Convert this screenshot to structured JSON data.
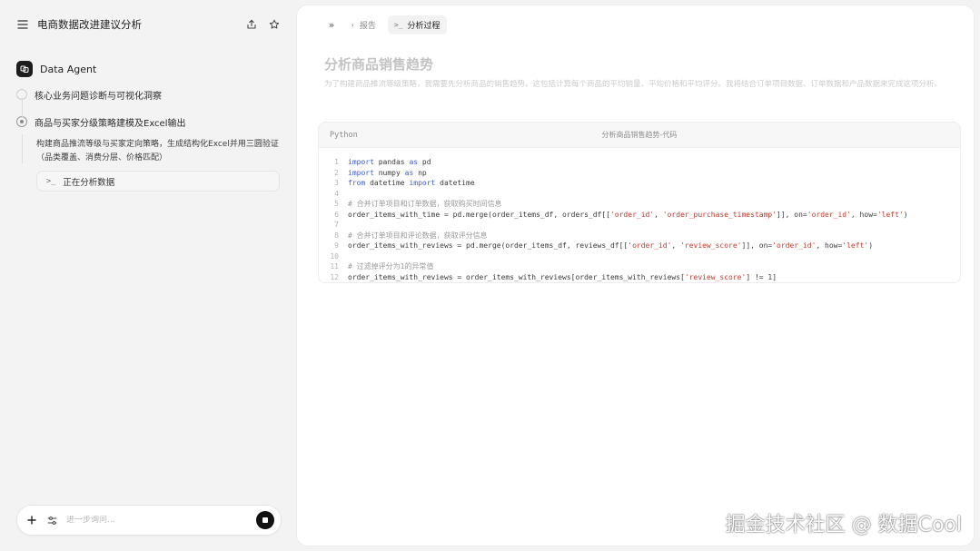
{
  "sidebar": {
    "title": "电商数据改进建议分析",
    "agent_name": "Data Agent",
    "steps": [
      {
        "label": "核心业务问题诊断与可视化洞察"
      },
      {
        "label": "商品与买家分级策略建模及Excel输出"
      }
    ],
    "step_description": "构建商品推流等级与买家定向策略，生成结构化Excel并用三圆验证（品类覆盖、消费分层、价格匹配）",
    "status": {
      "icon_text": ">_",
      "label": "正在分析数据"
    },
    "input": {
      "placeholder": "进一步询问..."
    }
  },
  "main": {
    "tabs": [
      {
        "label": "报告",
        "icon_text": "‹"
      },
      {
        "label": "分析过程",
        "icon_text": ">_",
        "active": true
      }
    ],
    "report_title": "分析商品销售趋势",
    "report_description": "为了构建商品推流等级策略，我需要先分析商品的销售趋势。这包括计算每个商品的平均销量、平均价格和平均评分。我将结合订单项目数据、订单数据和产品数据来完成这项分析。",
    "code_block": {
      "language": "Python",
      "title": "分析商品销售趋势-代码",
      "lines": [
        {
          "n": "1",
          "parts": [
            [
              "kw",
              "import"
            ],
            [
              "p",
              " pandas "
            ],
            [
              "kw",
              "as"
            ],
            [
              "p",
              " pd"
            ]
          ]
        },
        {
          "n": "2",
          "parts": [
            [
              "kw",
              "import"
            ],
            [
              "p",
              " numpy "
            ],
            [
              "kw",
              "as"
            ],
            [
              "p",
              " np"
            ]
          ]
        },
        {
          "n": "3",
          "parts": [
            [
              "kw",
              "from"
            ],
            [
              "p",
              " datetime "
            ],
            [
              "kw",
              "import"
            ],
            [
              "p",
              " datetime"
            ]
          ]
        },
        {
          "n": "4",
          "parts": []
        },
        {
          "n": "5",
          "parts": [
            [
              "cm",
              "# 合并订单项目和订单数据，获取购买时间信息"
            ]
          ]
        },
        {
          "n": "6",
          "parts": [
            [
              "p",
              "order_items_with_time = pd.merge(order_items_df, orders_df[["
            ],
            [
              "str",
              "'order_id'"
            ],
            [
              "p",
              ", "
            ],
            [
              "str",
              "'order_purchase_timestamp'"
            ],
            [
              "p",
              "]], on="
            ],
            [
              "str",
              "'order_id'"
            ],
            [
              "p",
              ", how="
            ],
            [
              "str",
              "'left'"
            ],
            [
              "p",
              ")"
            ]
          ]
        },
        {
          "n": "7",
          "parts": []
        },
        {
          "n": "8",
          "parts": [
            [
              "cm",
              "# 合并订单项目和评论数据，获取评分信息"
            ]
          ]
        },
        {
          "n": "9",
          "parts": [
            [
              "p",
              "order_items_with_reviews = pd.merge(order_items_df, reviews_df[["
            ],
            [
              "str",
              "'order_id'"
            ],
            [
              "p",
              ", "
            ],
            [
              "str",
              "'review_score'"
            ],
            [
              "p",
              "]], on="
            ],
            [
              "str",
              "'order_id'"
            ],
            [
              "p",
              ", how="
            ],
            [
              "str",
              "'left'"
            ],
            [
              "p",
              ")"
            ]
          ]
        },
        {
          "n": "10",
          "parts": []
        },
        {
          "n": "11",
          "parts": [
            [
              "cm",
              "# 过滤掉评分为1的异常值"
            ]
          ]
        },
        {
          "n": "12",
          "parts": [
            [
              "p",
              "order_items_with_reviews = order_items_with_reviews[order_items_with_reviews["
            ],
            [
              "str",
              "'review_score'"
            ],
            [
              "p",
              "] != 1]"
            ]
          ]
        }
      ]
    }
  },
  "watermark": "掘金技术社区 @ 数据Cool",
  "icons": {
    "menu": "menu-icon",
    "share": "share-icon",
    "star": "star-icon",
    "agent": "agent-logo-icon",
    "add": "plus-icon",
    "settings": "sliders-icon",
    "stop": "stop-icon",
    "expand": "double-chevron-icon",
    "terminal": "terminal-icon"
  },
  "colors": {
    "keyword": "#3b5bd9",
    "string": "#c0392b",
    "comment": "#9a9a9a"
  }
}
